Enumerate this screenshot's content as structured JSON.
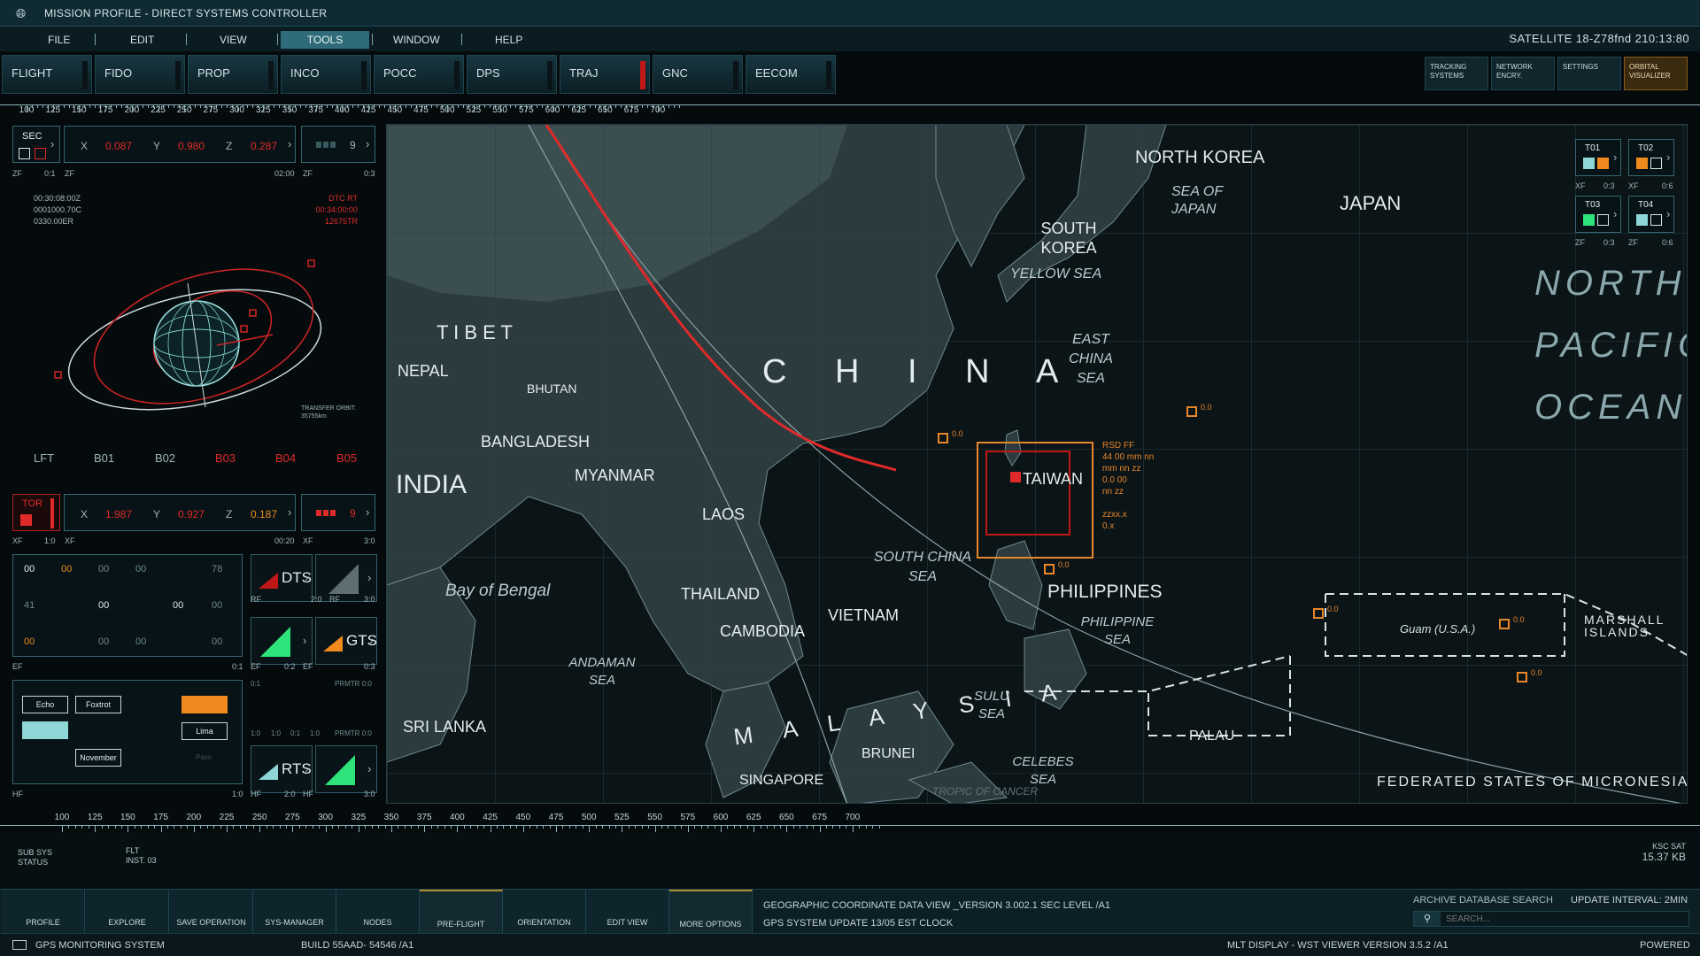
{
  "window": {
    "title": "MISSION PROFILE - DIRECT SYSTEMS CONTROLLER"
  },
  "menu": {
    "file": "FILE",
    "edit": "EDIT",
    "view": "VIEW",
    "tools": "TOOLS",
    "window": "WINDOW",
    "help": "HELP"
  },
  "satellite_readout": "SATELLITE  18-Z78fnd 210:13:80",
  "console_tabs": [
    "FLIGHT",
    "FIDO",
    "PROP",
    "INCO",
    "POCC",
    "DPS",
    "TRAJ",
    "GNC",
    "EECOM"
  ],
  "top_right_buttons": {
    "tracking": "TRACKING SYSTEMS",
    "network": "NETWORK ENCRY.",
    "settings": "SETTINGS",
    "orbital": "ORBITAL VISUALIZER"
  },
  "ruler_top": [
    "100",
    "125",
    "150",
    "175",
    "200",
    "225",
    "250",
    "275",
    "300",
    "325",
    "350",
    "375",
    "400",
    "425",
    "450",
    "475",
    "500",
    "525",
    "550",
    "575",
    "600",
    "625",
    "650",
    "675",
    "700"
  ],
  "ruler_bottom": [
    "100",
    "125",
    "150",
    "175",
    "200",
    "225",
    "250",
    "275",
    "300",
    "325",
    "350",
    "375",
    "400",
    "425",
    "450",
    "475",
    "500",
    "525",
    "550",
    "575",
    "600",
    "625",
    "650",
    "675",
    "700"
  ],
  "sec_panel": {
    "sec_label": "SEC",
    "x_label": "X",
    "x_val": "0.087",
    "y_label": "Y",
    "y_val": "0.980",
    "z_label": "Z",
    "z_val": "0.287",
    "bar_count": "9",
    "zf_left": "ZF",
    "ratio_left": "0:1",
    "zf_mid": "ZF",
    "time_mid": "02:00",
    "zf_right": "ZF",
    "ratio_right": "0:3"
  },
  "orbit_info": {
    "left_lines": [
      "00:30:08:00Z",
      "0001000.70C",
      "0330.00ER"
    ],
    "right_lines": [
      "DTC RT",
      "00:34:00:00",
      "12675TR"
    ],
    "transfer_label": "TRANSFER ORBIT.",
    "transfer_value": "35755km"
  },
  "b_tabs": [
    "LFT",
    "B01",
    "B02",
    "B03",
    "B04",
    "B05"
  ],
  "tor_panel": {
    "tor_label": "TOR",
    "x_label": "X",
    "x_val": "1.987",
    "y_label": "Y",
    "y_val": "0.927",
    "z_label": "Z",
    "z_val": "0.187",
    "bar_count": "9",
    "xf_left": "XF",
    "ratio_left": "1:0",
    "xf_mid": "XF",
    "time_mid": "00:20",
    "xf_right": "XF",
    "ratio_right": "3:0"
  },
  "grid_panel": {
    "row1": [
      "00",
      "00",
      "00",
      "00",
      "78"
    ],
    "row2": [
      "41",
      "00",
      "00",
      "00"
    ],
    "row3": [
      "00",
      "00",
      "00",
      "00"
    ],
    "ef": "EF",
    "ratio": "0:1"
  },
  "modules": {
    "dts": "DTS",
    "gts": "GTS",
    "rts": "RTS",
    "rf1": "RF",
    "rf1_ratio": "2:0",
    "rf2": "RF",
    "rf2_ratio": "3:0",
    "ef1": "EF",
    "ef1_ratio": "0:2",
    "ef2": "EF",
    "ef2_ratio": "0:3",
    "hf1": "HF",
    "hf1_ratio": "2:0",
    "hf2": "HF",
    "hf2_ratio": "3:0",
    "prmtr1": "PRMTR 0:0",
    "prmtr2": "PRMTR 0:0",
    "r01": "0:1",
    "r10a": "1:0",
    "r10b": "1:0",
    "r01b": "0:1",
    "r10c": "1:0"
  },
  "phonetic_panel": {
    "echo": "Echo",
    "foxtrot": "Foxtrot",
    "lima": "Lima",
    "november": "November",
    "faint": "Pass",
    "hf": "HF",
    "ratio": "1:0"
  },
  "map": {
    "countries": {
      "north_korea": "NORTH KOREA",
      "south_korea": "SOUTH KOREA",
      "japan": "JAPAN",
      "tibet": "T I B E T",
      "nepal": "NEPAL",
      "bhutan": "BHUTAN",
      "bangladesh": "BANGLADESH",
      "india": "INDIA",
      "myanmar": "MYANMAR",
      "laos": "LAOS",
      "thailand": "THAILAND",
      "cambodia": "CAMBODIA",
      "vietnam": "VIETNAM",
      "taiwan": "TAIWAN",
      "philippines": "PHILIPPINES",
      "sri_lanka": "SRI LANKA",
      "brunei": "BRUNEI",
      "singapore": "SINGAPORE",
      "palau": "PALAU",
      "china": "C H I N A",
      "malaysia": "M A L A Y S I A",
      "marshall": "MARSHALL ISLANDS",
      "micronesia": "FEDERATED STATES OF MICRONESIA",
      "guam": "Guam (U.S.A.)"
    },
    "seas": {
      "sea_of_japan": "SEA OF JAPAN",
      "yellow_sea": "YELLOW SEA",
      "east_china_sea": "EAST CHINA SEA",
      "south_china_sea": "SOUTH CHINA SEA",
      "philippine_sea": "PHILIPPINE SEA",
      "andaman_sea": "ANDAMAN SEA",
      "sulu_sea": "SULU SEA",
      "celebes_sea": "CELEBES SEA",
      "bay_of_bengal": "Bay of Bengal",
      "tropic": "TROPIC OF CANCER"
    },
    "ocean": {
      "l1": "NORTH",
      "l2": "PACIFIC",
      "l3": "OCEAN"
    },
    "marker_value": "0.0",
    "target_info": [
      "RSD FF",
      "44 00 mm nn",
      "mm nn zz",
      "0.0 00",
      "nn zz",
      "",
      "zzxx.x",
      "0.x"
    ],
    "targets": {
      "t01": "T01",
      "t02": "T02",
      "t03": "T03",
      "t04": "T04",
      "xf1": "XF",
      "r1": "0:3",
      "xf2": "XF",
      "r2": "0:6",
      "zf1": "ZF",
      "r3": "0:3",
      "zf2": "ZF",
      "r4": "0:6"
    }
  },
  "subsys": {
    "label1": "SUB SYS",
    "label2": "STATUS",
    "flt1": "FLT",
    "flt2": "INST. 03",
    "ksc": "KSC SAT",
    "size": "15.37 KB"
  },
  "bottom_buttons": [
    "PROFILE",
    "EXPLORE",
    "SAVE OPERATION",
    "SYS-MANAGER",
    "NODES",
    "PRE-FLIGHT",
    "ORIENTATION",
    "EDIT VIEW",
    "MORE OPTIONS"
  ],
  "bottom_info": {
    "line1": "GEOGRAPHIC COORDINATE DATA VIEW _VERSION 3.002.1 SEC LEVEL /A1",
    "line2": "GPS SYSTEM UPDATE 13/05 EST CLOCK",
    "archive": "ARCHIVE DATABASE SEARCH",
    "update": "UPDATE INTERVAL: 2MIN",
    "search_placeholder": "SEARCH..."
  },
  "status": {
    "gps": "GPS MONITORING SYSTEM",
    "build": "BUILD 55AAD- 54546  /A1",
    "display": "MLT  DISPLAY - WST VIEWER  VERSION 3.5.2 /A1",
    "powered": "POWERED"
  },
  "colors": {
    "accent_red": "#e02a2a",
    "accent_orange": "#f08a1e",
    "accent_teal": "#8fd6d6",
    "accent_green": "#2ee37a"
  }
}
